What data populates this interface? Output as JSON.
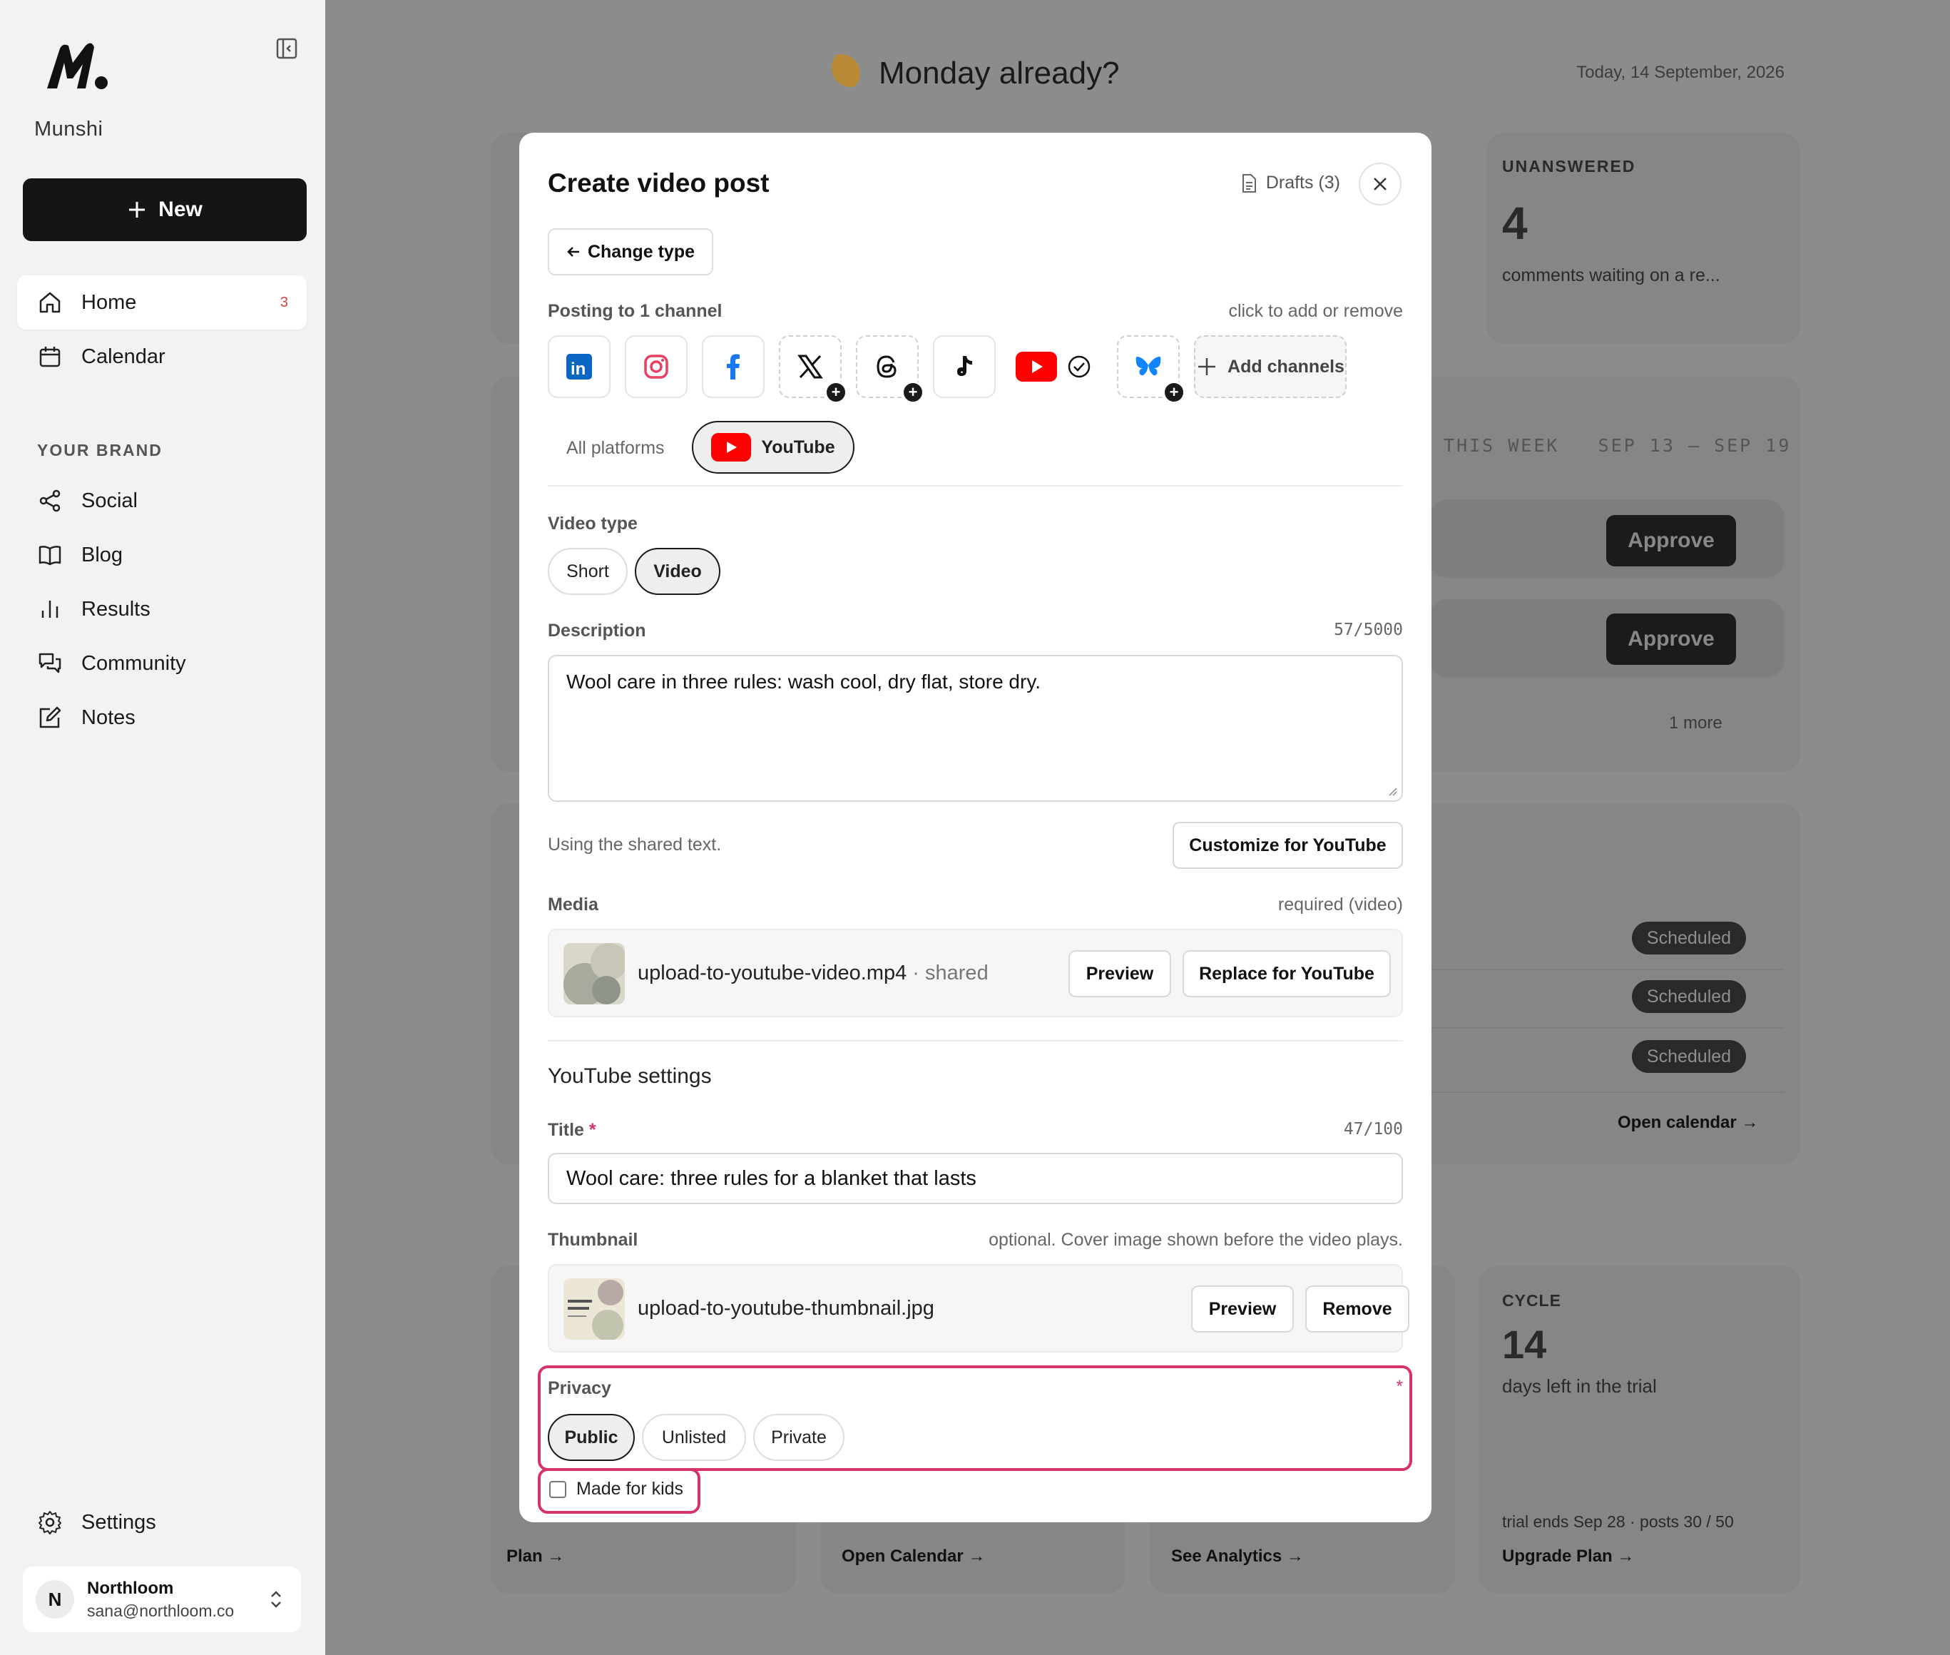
{
  "sidebar": {
    "brand": "Munshi",
    "new_label": "New",
    "nav": [
      {
        "label": "Home",
        "badge": "3",
        "icon": "home-icon"
      },
      {
        "label": "Calendar",
        "icon": "calendar-icon"
      }
    ],
    "section_label": "YOUR BRAND",
    "brand_nav": [
      {
        "label": "Social",
        "icon": "share-icon"
      },
      {
        "label": "Blog",
        "icon": "book-icon"
      },
      {
        "label": "Results",
        "icon": "bar-chart-icon"
      },
      {
        "label": "Community",
        "icon": "chat-icon"
      },
      {
        "label": "Notes",
        "icon": "edit-icon"
      }
    ],
    "settings_label": "Settings",
    "user": {
      "initial": "N",
      "name": "Northloom",
      "email": "sana@northloom.co"
    }
  },
  "background": {
    "greeting": "Monday already?",
    "today": "Today, 14 September, 2026",
    "unanswered_label": "UNANSWERED",
    "unanswered_count": "4",
    "unanswered_text": "comments waiting on a re...",
    "this_week": "THIS WEEK   SEP 13 – SEP 19",
    "approve_label": "Approve",
    "more_label": "1 more",
    "scheduled_label": "Scheduled",
    "open_calendar": "Open calendar →",
    "cycle_label": "CYCLE",
    "cycle_count": "14",
    "cycle_text": "days left in the trial",
    "cycle_foot": "trial ends Sep 28 · posts 30 / 50",
    "upgrade": "Upgrade Plan →",
    "plan_link": "Plan →",
    "open_cal_link": "Open Calendar →",
    "analytics_link": "See Analytics →"
  },
  "modal": {
    "title": "Create video post",
    "drafts": "Drafts (3)",
    "change_type": "Change type",
    "posting_label": "Posting to 1 channel",
    "posting_hint": "click to add or remove",
    "add_channels": "Add channels",
    "platform_tabs": {
      "all": "All platforms",
      "youtube": "YouTube"
    },
    "video_type_label": "Video type",
    "video_types": [
      "Short",
      "Video"
    ],
    "description_label": "Description",
    "description_count": "57/5000",
    "description_value": "Wool care in three rules: wash cool, dry flat, store dry.",
    "shared_text_note": "Using the shared text.",
    "customize_label": "Customize for YouTube",
    "media_label": "Media",
    "media_hint": "required (video)",
    "media_file": "upload-to-youtube-video.mp4",
    "media_shared": " · shared",
    "preview_label": "Preview",
    "replace_label": "Replace for YouTube",
    "yt_settings": "YouTube settings",
    "title_label": "Title",
    "title_required": "*",
    "title_count": "47/100",
    "title_value": "Wool care: three rules for a blanket that lasts",
    "thumbnail_label": "Thumbnail",
    "thumbnail_hint": "optional. Cover image shown before the video plays.",
    "thumbnail_file": "upload-to-youtube-thumbnail.jpg",
    "remove_label": "Remove",
    "privacy_label": "Privacy",
    "privacy_required": "*",
    "privacy_options": [
      "Public",
      "Unlisted",
      "Private"
    ],
    "privacy_selected": "Public",
    "made_for_kids": "Made for kids",
    "made_for_kids_checked": false
  },
  "colors": {
    "highlight": "#d6336c",
    "youtube": "#ff0000",
    "linkedin": "#0a66c2",
    "facebook": "#1877f2",
    "bluesky": "#1185fe"
  }
}
